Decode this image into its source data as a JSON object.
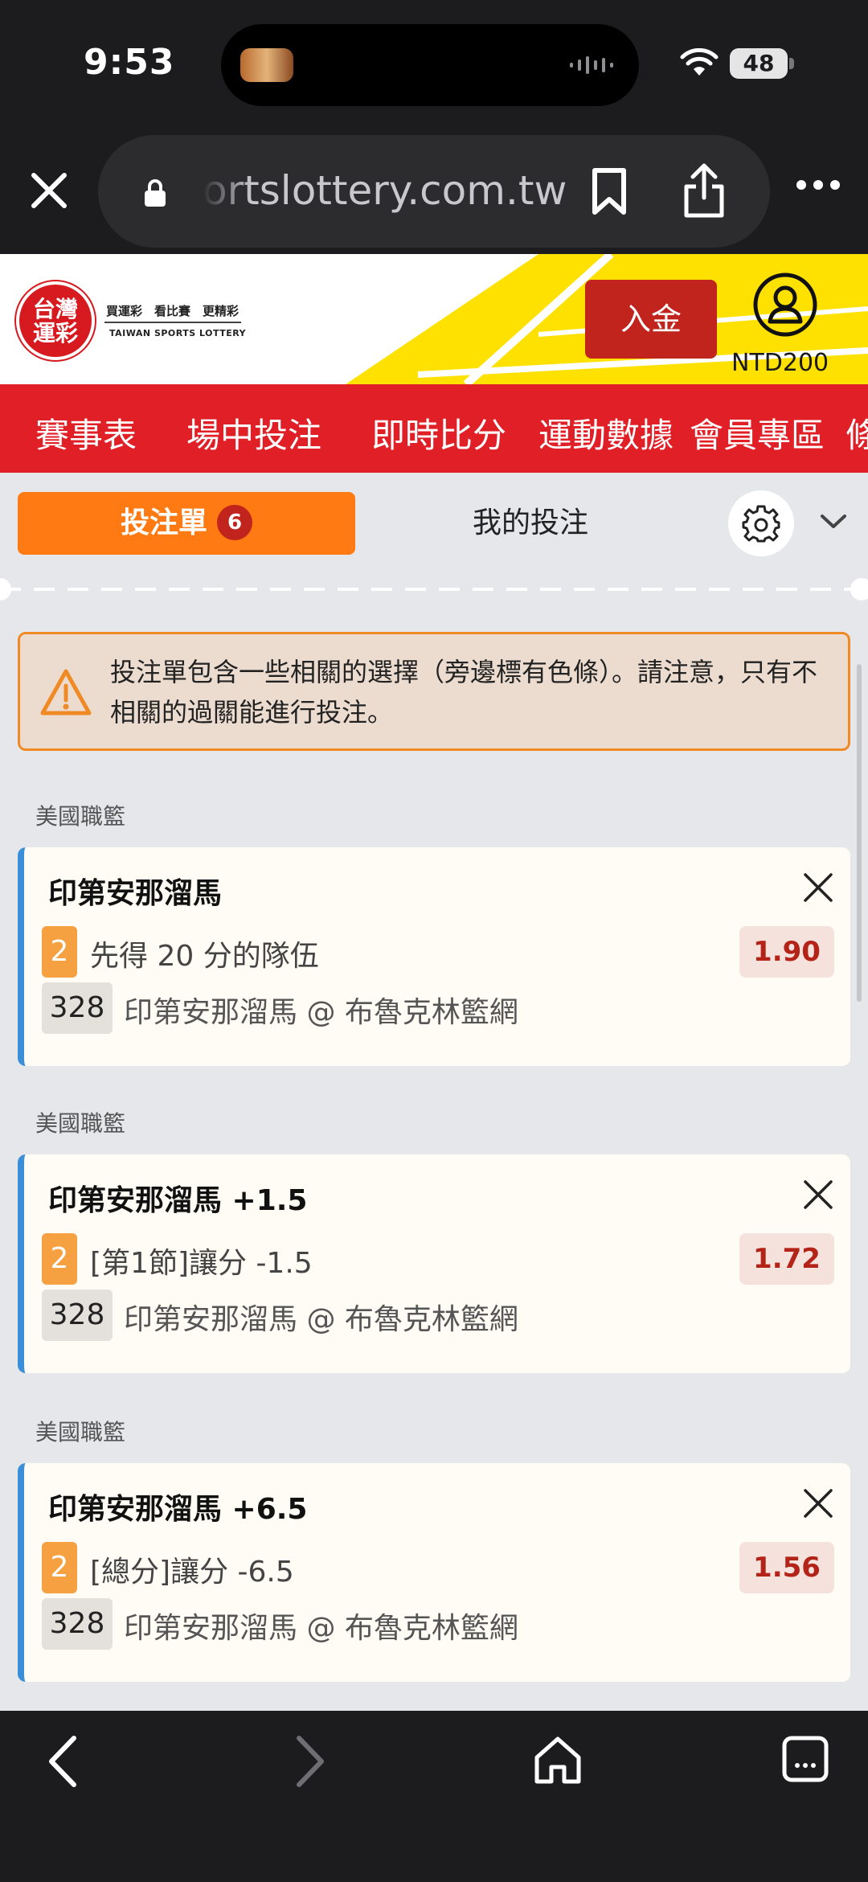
{
  "status_bar": {
    "time": "9:53",
    "battery": "48"
  },
  "browser": {
    "url": "ortslottery.com.tw"
  },
  "header": {
    "logo_line1": "台灣",
    "logo_line2": "運彩",
    "logo_slogan": "買運彩　看比賽　更精彩",
    "logo_english": "TAIWAN SPORTS LOTTERY",
    "deposit_label": "入金",
    "balance": "NTD200",
    "brand_red": "#e01f26",
    "brand_yellow": "#ffe100"
  },
  "nav": {
    "items": [
      "賽事表",
      "場中投注",
      "即時比分",
      "運動數據",
      "會員專區",
      "條"
    ]
  },
  "betslip": {
    "tab_label": "投注單",
    "count": "6",
    "my_bets_label": "我的投注",
    "warning": "投注單包含一些相關的選擇（旁邊標有色條）。請注意，只有不相關的過關能進行投注。",
    "bets": [
      {
        "league": "美國職籃",
        "title": "印第安那溜馬",
        "sel_badge": "2",
        "selection": "先得 20 分的隊伍",
        "odds": "1.90",
        "game_no": "328",
        "match": "印第安那溜馬 @ 布魯克林籃網"
      },
      {
        "league": "美國職籃",
        "title": "印第安那溜馬 +1.5",
        "sel_badge": "2",
        "selection": "[第1節]讓分 -1.5",
        "odds": "1.72",
        "game_no": "328",
        "match": "印第安那溜馬 @ 布魯克林籃網"
      },
      {
        "league": "美國職籃",
        "title": "印第安那溜馬 +6.5",
        "sel_badge": "2",
        "selection": "[總分]讓分 -6.5",
        "odds": "1.56",
        "game_no": "328",
        "match": "印第安那溜馬 @ 布魯克林籃網"
      }
    ]
  }
}
